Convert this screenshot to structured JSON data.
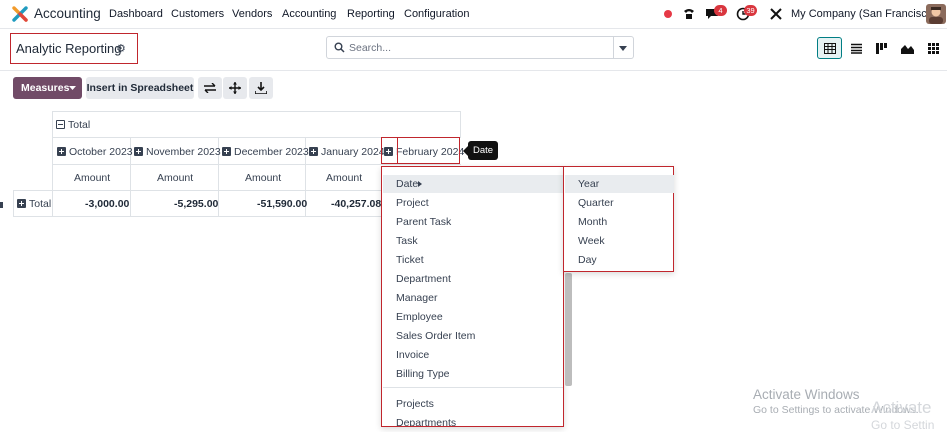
{
  "navbar": {
    "app_name": "Accounting",
    "menu": [
      "Dashboard",
      "Customers",
      "Vendors",
      "Accounting",
      "Reporting",
      "Configuration"
    ],
    "messages_badge": "4",
    "activities_badge": "39",
    "company": "My Company (San Francisco)"
  },
  "control_panel": {
    "title": "Analytic Reporting",
    "search_placeholder": "Search...",
    "measures_label": "Measures",
    "insert_label": "Insert in Spreadsheet"
  },
  "pivot": {
    "total_header": "Total",
    "columns": [
      "October 2023",
      "November 2023",
      "December 2023",
      "January 2024",
      "February 2024"
    ],
    "measure_label": "Amount",
    "row_header": "Total",
    "values": [
      "-3,000.00",
      "-5,295.00",
      "-51,590.00",
      "-40,257.08"
    ]
  },
  "tooltip": "Date",
  "groupby_menu": {
    "items": [
      "Date",
      "Project",
      "Parent Task",
      "Task",
      "Ticket",
      "Department",
      "Manager",
      "Employee",
      "Sales Order Item",
      "Invoice",
      "Billing Type"
    ],
    "extra_items": [
      "Projects",
      "Departments"
    ]
  },
  "date_submenu": {
    "items": [
      "Year",
      "Quarter",
      "Month",
      "Week",
      "Day"
    ]
  },
  "watermark": {
    "title": "Activate Windows",
    "subtitle": "Go to Settings to activate Windows.",
    "ghost_title": "Activate",
    "ghost_subtitle": "Go to Settin"
  }
}
